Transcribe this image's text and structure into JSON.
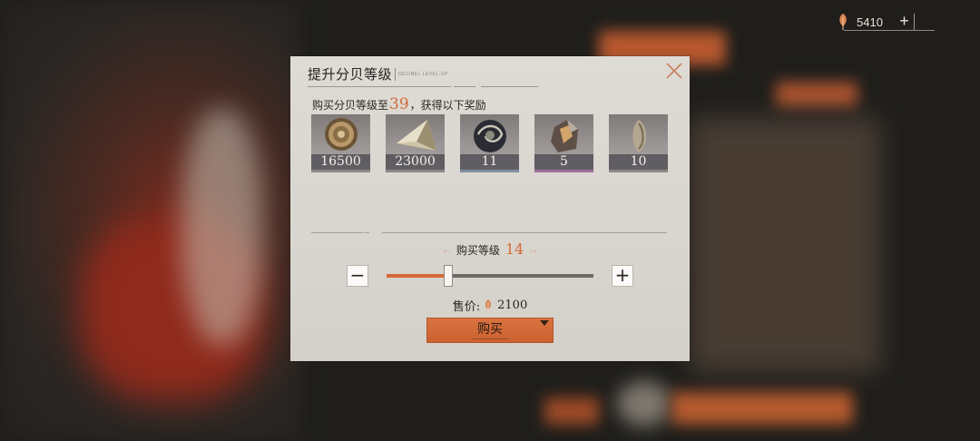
{
  "currency": {
    "icon": "feather-icon",
    "amount": "5410",
    "plus_label": "+"
  },
  "dialog": {
    "title": "提升分贝等级",
    "subtitle": "DECIBEL LEVEL-UP",
    "close_icon": "close-icon",
    "reward_prefix": "购买分贝等级至",
    "target_level": "39",
    "reward_suffix": "，获得以下奖励",
    "rewards": [
      {
        "icon": "coin-medal-icon",
        "count": "16500",
        "rarity_color": "#8d8683"
      },
      {
        "icon": "crystal-shard-icon",
        "count": "23000",
        "rarity_color": "#8d8683"
      },
      {
        "icon": "swirl-orb-icon",
        "count": "11",
        "rarity_color": "#7f8fa0"
      },
      {
        "icon": "ore-chunk-icon",
        "count": "5",
        "rarity_color": "#9b6e9a"
      },
      {
        "icon": "seed-stone-icon",
        "count": "10",
        "rarity_color": "#8d8683"
      }
    ],
    "buy_level_label": "购买等级",
    "buy_level_value": "14",
    "slider_fraction": 0.3,
    "minus_label": "−",
    "plus_label": "+",
    "price_label": "售价:",
    "price_icon": "feather-icon",
    "price_value": "2100",
    "buy_button_label": "购买"
  },
  "colors": {
    "accent": "#d36a36",
    "panel": "#dedad4",
    "text": "#2a2623"
  }
}
